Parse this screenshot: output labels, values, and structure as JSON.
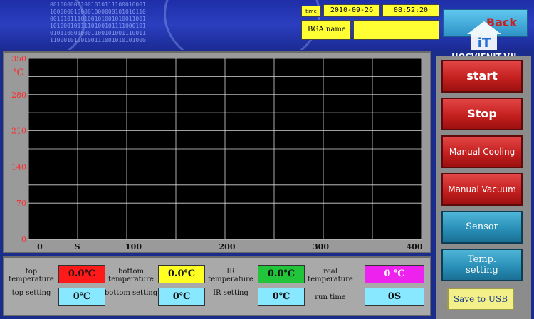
{
  "header": {
    "binary_text": "0010000001001010111100010001\n1000000100001000000101010110\n0010101110100101001010011001\n1010001011110100101111000101\n0101100010001100101001110011\n1100010100100111001010101000",
    "time_label": "time",
    "date": "2010-09-26",
    "time": "08:52:20",
    "bga_name_label": "BGA name",
    "bga_name_value": "",
    "back_button": "Back",
    "logo_text": "HOCVIENIT.VN",
    "logo_mark": "iT"
  },
  "chart_data": {
    "type": "line",
    "y_unit": "℃",
    "ylim": [
      0,
      350
    ],
    "y_ticks": [
      "0",
      "70",
      "140",
      "210",
      "280",
      "350"
    ],
    "x_ticks": [
      "0",
      "S",
      "100",
      "200",
      "300",
      "400"
    ],
    "x_tick_values": [
      0,
      40,
      100,
      200,
      300,
      400
    ],
    "xlim": [
      0,
      400
    ],
    "grid": true,
    "series": []
  },
  "readings": {
    "top_temperature_label": "top temperature",
    "top_temperature_value": "0.0℃",
    "bottom_temperature_label": "bottom temperature",
    "bottom_temperature_value": "0.0℃",
    "ir_temperature_label": "IR temperature",
    "ir_temperature_value": "0.0℃",
    "real_temperature_label": "real temperature",
    "real_temperature_value": "0 ℃",
    "top_setting_label": "top setting",
    "top_setting_value": "0℃",
    "bottom_setting_label": "bottom setting",
    "bottom_setting_value": "0℃",
    "ir_setting_label": "IR setting",
    "ir_setting_value": "0℃",
    "run_time_label": "run time",
    "run_time_value": "0S"
  },
  "controls": {
    "start": "start",
    "stop": "Stop",
    "manual_cooling": "Manual Cooling",
    "manual_vacuum": "Manual Vacuum",
    "sensor": "Sensor",
    "temp_setting": "Temp. setting",
    "save_to_usb": "Save to USB"
  },
  "colors": {
    "top_temp": "#ff1a1a",
    "bottom_temp": "#ffff22",
    "ir_temp": "#22c43a",
    "real_temp": "#ee22ee",
    "setting": "#88e8ff",
    "chart_bg": "#000000",
    "tick_y": "#ff2a2a",
    "tick_x": "#111111"
  }
}
